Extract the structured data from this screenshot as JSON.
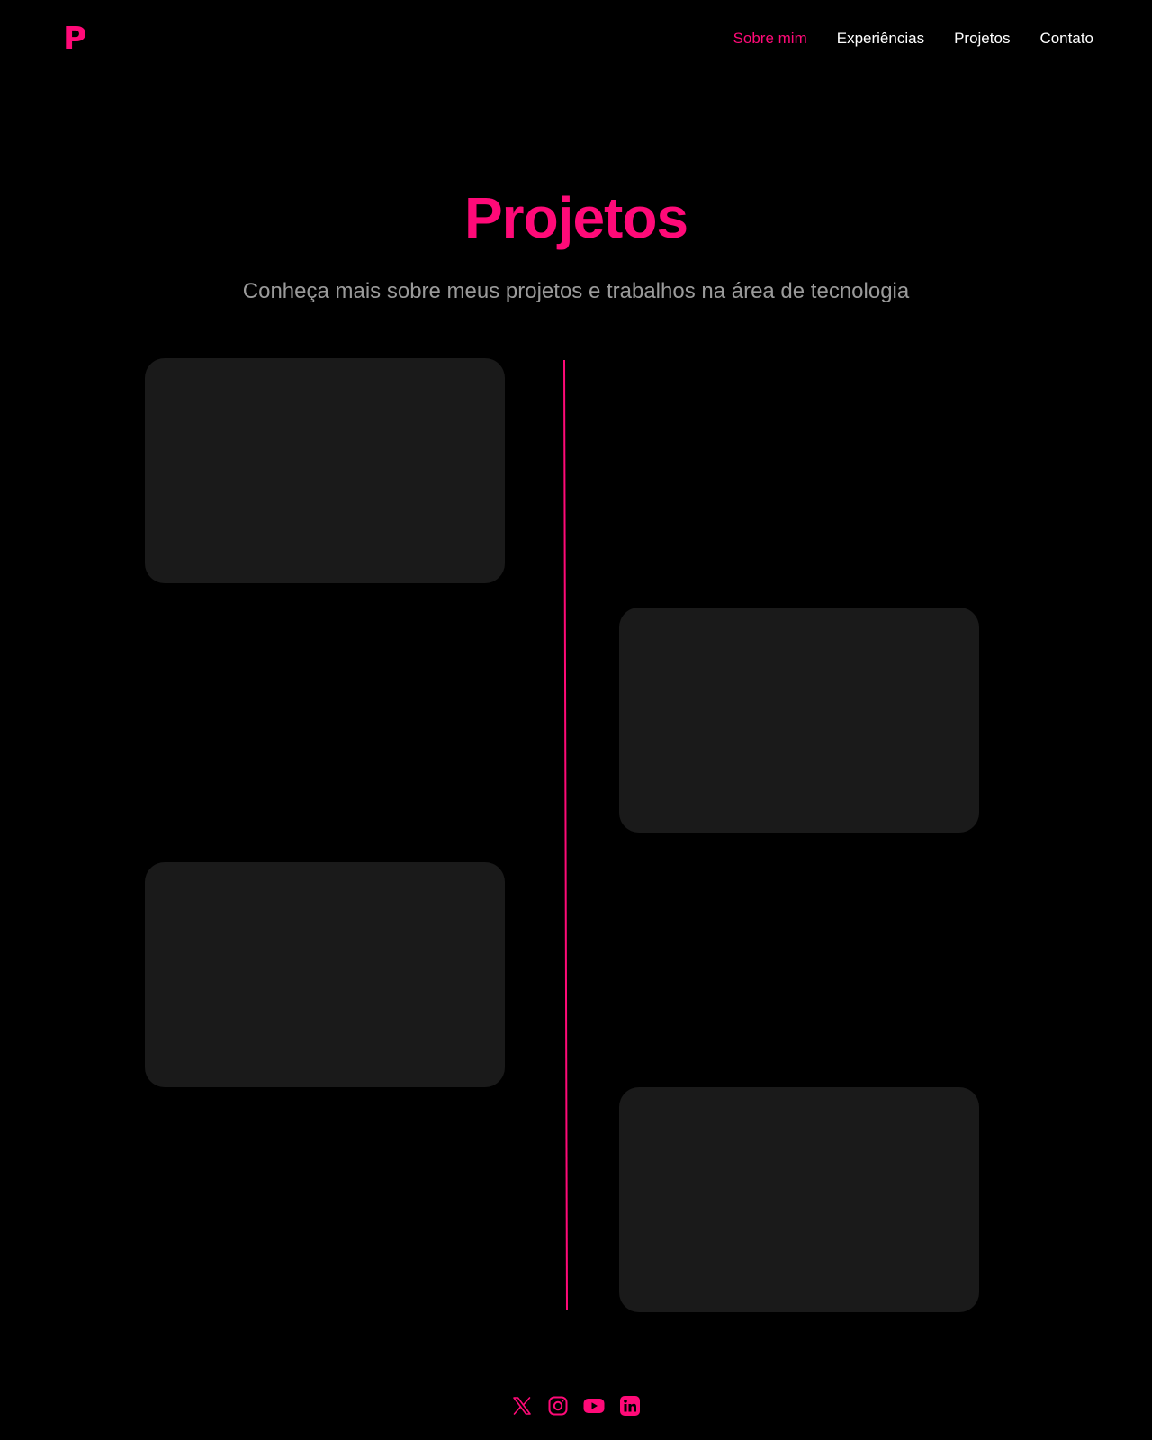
{
  "header": {
    "logo": "P",
    "nav": [
      {
        "label": "Sobre mim",
        "active": true
      },
      {
        "label": "Experiências",
        "active": false
      },
      {
        "label": "Projetos",
        "active": false
      },
      {
        "label": "Contato",
        "active": false
      }
    ]
  },
  "main": {
    "title": "Projetos",
    "subtitle": "Conheça mais sobre meus projetos e trabalhos na área de tecnologia",
    "project_cards": [
      {
        "side": "left"
      },
      {
        "side": "right"
      },
      {
        "side": "left"
      },
      {
        "side": "right"
      }
    ]
  },
  "footer": {
    "socials": [
      {
        "icon": "x-twitter-icon"
      },
      {
        "icon": "instagram-icon"
      },
      {
        "icon": "youtube-icon"
      },
      {
        "icon": "linkedin-icon"
      }
    ]
  },
  "colors": {
    "accent": "#ff0a78",
    "background": "#000000",
    "card": "#1a1a1a",
    "subtitle": "#9a9a9a",
    "nav_text": "#ffffff"
  }
}
